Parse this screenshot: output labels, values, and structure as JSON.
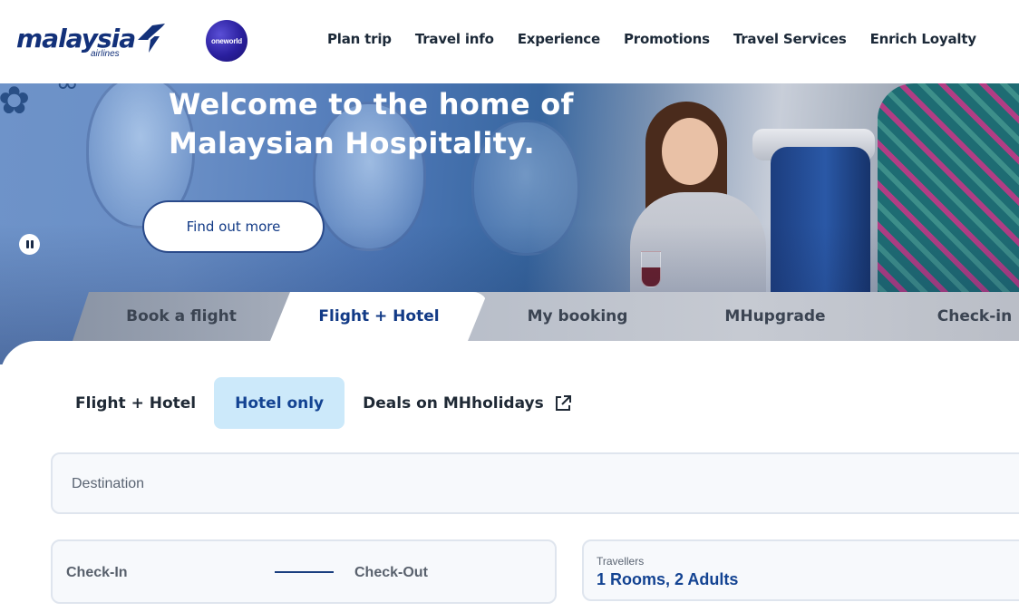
{
  "brand": {
    "logo_text": "malaysia",
    "logo_subtext": "airlines",
    "alliance_badge": "oneworld",
    "colors": {
      "primary": "#13317a",
      "accent": "#134392",
      "active_tab_bg": "#cce9fa"
    }
  },
  "nav": {
    "items": [
      {
        "label": "Plan trip"
      },
      {
        "label": "Travel info"
      },
      {
        "label": "Experience"
      },
      {
        "label": "Promotions"
      },
      {
        "label": "Travel Services"
      },
      {
        "label": "Enrich Loyalty"
      }
    ]
  },
  "hero": {
    "title_line1": "Welcome to the home of",
    "title_line2": "Malaysian Hospitality.",
    "cta_label": "Find out more",
    "carousel_control_icon": "pause-icon"
  },
  "booking_tabs": {
    "items": [
      {
        "label": "Book a flight"
      },
      {
        "label": "Flight + Hotel"
      },
      {
        "label": "My booking"
      },
      {
        "label": "MHupgrade"
      },
      {
        "label": "Check-in"
      }
    ],
    "active": "Flight + Hotel"
  },
  "sub_tabs": {
    "items": [
      {
        "label": "Flight + Hotel"
      },
      {
        "label": "Hotel only"
      },
      {
        "label": "Deals on MHholidays",
        "icon": "external-link-icon"
      }
    ],
    "active": "Hotel only"
  },
  "form": {
    "destination_placeholder": "Destination",
    "check_in_label": "Check-In",
    "check_out_label": "Check-Out",
    "travellers_label": "Travellers",
    "travellers_value": "1 Rooms, 2 Adults"
  }
}
